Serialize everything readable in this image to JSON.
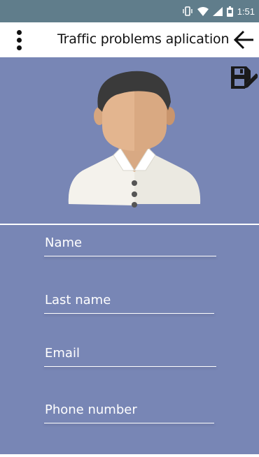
{
  "status_bar": {
    "time": "1:51",
    "icons": [
      "vibrate-icon",
      "wifi-icon",
      "signal-icon",
      "battery-icon"
    ]
  },
  "app_bar": {
    "title": "Traffic problems aplication",
    "menu_icon": "more-vert-icon",
    "back_icon": "arrow-back-icon"
  },
  "profile": {
    "avatar_icon": "user-avatar",
    "save_icon": "save-edit-icon"
  },
  "form": {
    "fields": [
      {
        "name": "name-field",
        "placeholder": "Name",
        "value": ""
      },
      {
        "name": "last-name-field",
        "placeholder": "Last name",
        "value": ""
      },
      {
        "name": "email-field",
        "placeholder": "Email",
        "value": ""
      },
      {
        "name": "phone-number-field",
        "placeholder": "Phone number",
        "value": ""
      }
    ]
  },
  "colors": {
    "status_bar": "#607d8b",
    "background": "#7886b5",
    "text_on_bg": "#ffffff",
    "app_bar": "#ffffff"
  }
}
